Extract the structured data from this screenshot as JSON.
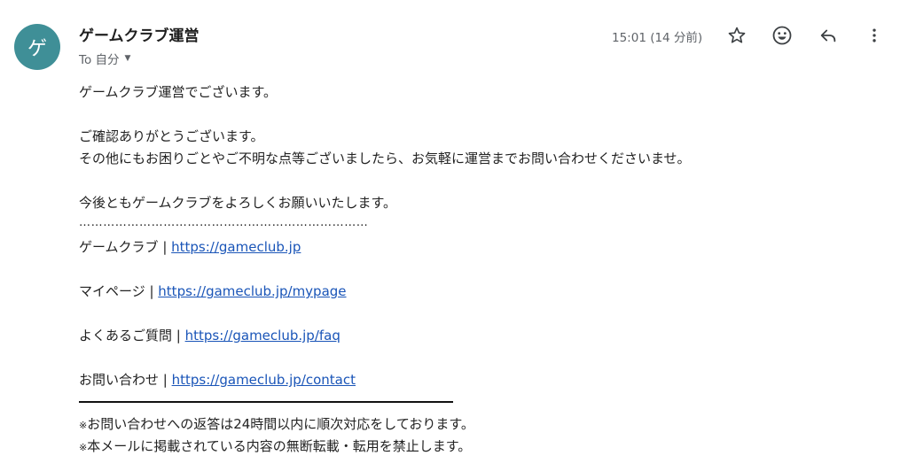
{
  "header": {
    "avatar_letter": "ゲ",
    "sender_name": "ゲームクラブ運営",
    "recipient_label": "To 自分",
    "timestamp": "15:01 (14 分前)"
  },
  "actions": {
    "star_icon": "star-outline-icon",
    "emoji_icon": "emoji-smile-icon",
    "reply_icon": "reply-icon",
    "more_icon": "more-vertical-icon"
  },
  "body": {
    "greeting": "ゲームクラブ運営でございます。",
    "para1_line1": "ご確認ありがとうございます。",
    "para1_line2": "その他にもお困りごとやご不明な点等ございましたら、お気軽に運営までお問い合わせくださいませ。",
    "closing": "今後ともゲームクラブをよろしくお願いいたします。",
    "dotted_rule": "………………………………………………………………",
    "links": [
      {
        "label": "ゲームクラブ | ",
        "url": "https://gameclub.jp"
      },
      {
        "label": "マイページ | ",
        "url": "https://gameclub.jp/mypage"
      },
      {
        "label": "よくあるご質問 | ",
        "url": "https://gameclub.jp/faq"
      },
      {
        "label": "お問い合わせ | ",
        "url": "https://gameclub.jp/contact"
      }
    ],
    "note_mark": "※",
    "note1": "お問い合わせへの返答は24時間以内に順次対応をしております。",
    "note2": "本メールに掲載されている内容の無断転載・転用を禁止します。"
  },
  "colors": {
    "avatar_bg": "#3f8f97",
    "link": "#1a55b8"
  }
}
